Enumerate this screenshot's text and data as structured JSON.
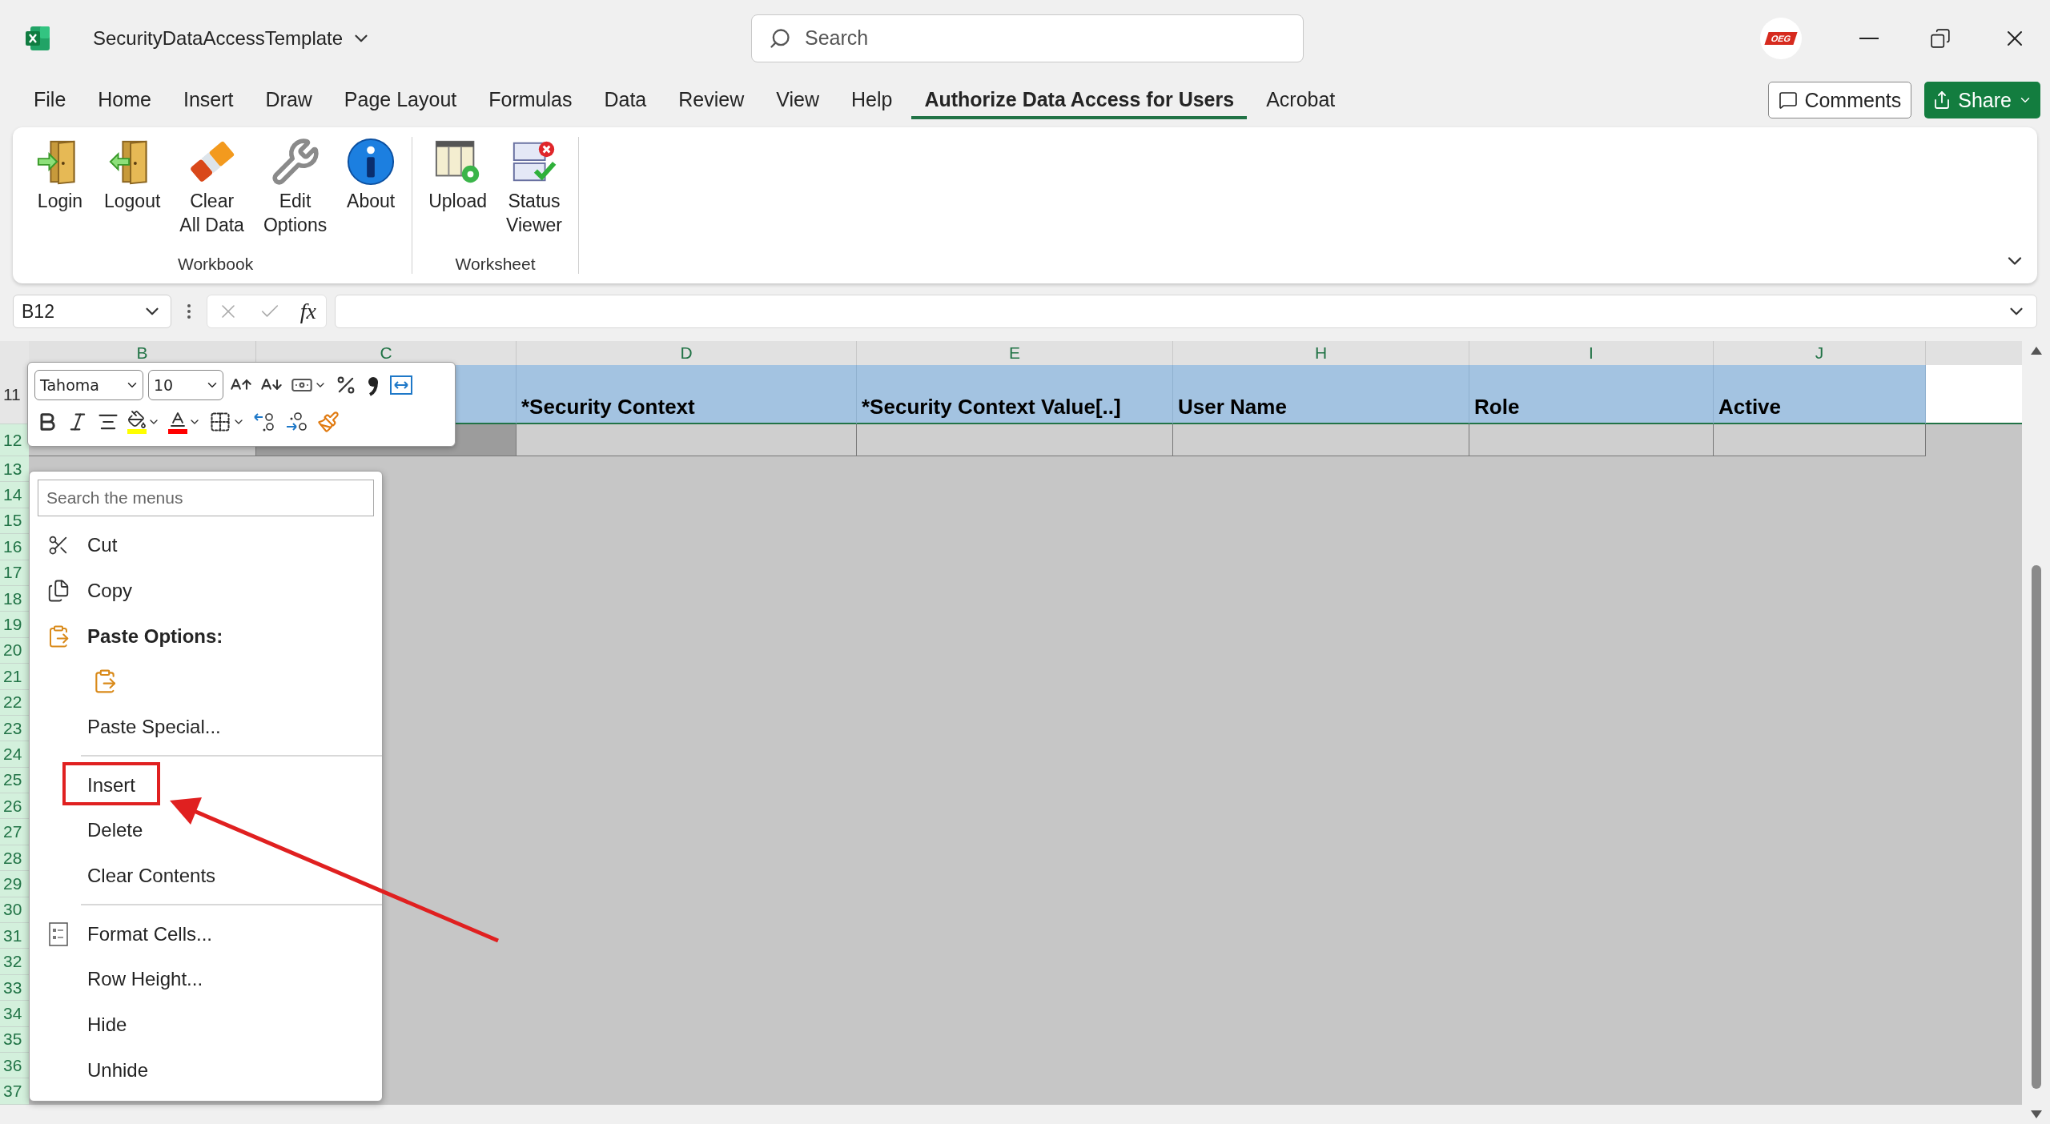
{
  "app": {
    "title": "SecurityDataAccessTemplate",
    "search_placeholder": "Search",
    "account_badge": "OEG"
  },
  "menu_tabs": [
    {
      "label": "File",
      "selected": false
    },
    {
      "label": "Home",
      "selected": false
    },
    {
      "label": "Insert",
      "selected": false
    },
    {
      "label": "Draw",
      "selected": false
    },
    {
      "label": "Page Layout",
      "selected": false
    },
    {
      "label": "Formulas",
      "selected": false
    },
    {
      "label": "Data",
      "selected": false
    },
    {
      "label": "Review",
      "selected": false
    },
    {
      "label": "View",
      "selected": false
    },
    {
      "label": "Help",
      "selected": false
    },
    {
      "label": "Authorize Data Access for Users",
      "selected": true
    },
    {
      "label": "Acrobat",
      "selected": false
    }
  ],
  "actions": {
    "comments": "Comments",
    "share": "Share"
  },
  "ribbon": {
    "groups": [
      {
        "label": "Workbook",
        "buttons": [
          {
            "lines": [
              "Login"
            ],
            "kind": "login"
          },
          {
            "lines": [
              "Logout"
            ],
            "kind": "logout"
          },
          {
            "lines": [
              "Clear",
              "All Data"
            ],
            "kind": "eraser"
          },
          {
            "lines": [
              "Edit",
              "Options"
            ],
            "kind": "wrench"
          },
          {
            "lines": [
              "About"
            ],
            "kind": "info"
          }
        ]
      },
      {
        "label": "Worksheet",
        "buttons": [
          {
            "lines": [
              "Upload"
            ],
            "kind": "upload"
          },
          {
            "lines": [
              "Status",
              "Viewer"
            ],
            "kind": "status"
          }
        ]
      }
    ]
  },
  "formula_bar": {
    "name_box": "B12",
    "function_label": "fx"
  },
  "mini_toolbar": {
    "font": "Tahoma",
    "size": "10",
    "rows": [
      [
        {
          "kind": "grow-font",
          "dropdown": false
        },
        {
          "kind": "shrink-font",
          "dropdown": false
        },
        {
          "kind": "accounting",
          "dropdown": true
        },
        {
          "kind": "percent",
          "dropdown": false
        },
        {
          "kind": "comma",
          "dropdown": false
        },
        {
          "kind": "merge",
          "dropdown": false
        }
      ],
      [
        {
          "kind": "bold",
          "dropdown": false
        },
        {
          "kind": "italic",
          "dropdown": false
        },
        {
          "kind": "center",
          "dropdown": false
        },
        {
          "kind": "fill-color",
          "dropdown": true,
          "color": "#ffff00"
        },
        {
          "kind": "font-color",
          "dropdown": true,
          "color": "#ff0000"
        },
        {
          "kind": "borders",
          "dropdown": true
        },
        {
          "kind": "increase-decimal",
          "dropdown": false
        },
        {
          "kind": "decrease-decimal",
          "dropdown": false
        },
        {
          "kind": "format-painter",
          "dropdown": false
        }
      ]
    ]
  },
  "context_menu": {
    "search_placeholder": "Search the menus",
    "items": [
      {
        "kind": "cut",
        "label": "Cut"
      },
      {
        "kind": "copy",
        "label": "Copy"
      },
      {
        "kind": "heading",
        "label": "Paste Options:"
      },
      {
        "kind": "paste-option"
      },
      {
        "kind": "item",
        "label": "Paste Special..."
      },
      {
        "kind": "separator"
      },
      {
        "kind": "item",
        "label": "Insert"
      },
      {
        "kind": "item",
        "label": "Delete"
      },
      {
        "kind": "item",
        "label": "Clear Contents"
      },
      {
        "kind": "separator"
      },
      {
        "kind": "format-cells",
        "label": "Format Cells..."
      },
      {
        "kind": "item",
        "label": "Row Height..."
      },
      {
        "kind": "item",
        "label": "Hide"
      },
      {
        "kind": "item",
        "label": "Unhide"
      }
    ]
  },
  "sheet": {
    "columns": [
      {
        "label": "B",
        "selected": true
      },
      {
        "label": "C",
        "selected": true
      },
      {
        "label": "D",
        "selected": true
      },
      {
        "label": "E",
        "selected": true
      },
      {
        "label": "H",
        "selected": true
      },
      {
        "label": "I",
        "selected": true
      },
      {
        "label": "J",
        "selected": true
      }
    ],
    "header_row": {
      "number": "11",
      "cells": [
        "*Security Context",
        "*Security Context Value[..]",
        "User Name",
        "Role",
        "Active"
      ]
    },
    "rows": [
      {
        "number": "12",
        "selected": true
      },
      {
        "number": "13",
        "selected": true
      },
      {
        "number": "14",
        "selected": true
      },
      {
        "number": "15",
        "selected": true
      },
      {
        "number": "16",
        "selected": true
      },
      {
        "number": "17",
        "selected": true
      },
      {
        "number": "18",
        "selected": true
      },
      {
        "number": "19",
        "selected": true
      },
      {
        "number": "20",
        "selected": true
      },
      {
        "number": "21",
        "selected": true
      },
      {
        "number": "22",
        "selected": true
      },
      {
        "number": "23",
        "selected": true
      },
      {
        "number": "24",
        "selected": true
      },
      {
        "number": "25",
        "selected": true
      },
      {
        "number": "26",
        "selected": true
      },
      {
        "number": "27",
        "selected": true
      },
      {
        "number": "28",
        "selected": true
      },
      {
        "number": "29",
        "selected": true
      },
      {
        "number": "30",
        "selected": true
      },
      {
        "number": "31",
        "selected": true
      },
      {
        "number": "32",
        "selected": true
      },
      {
        "number": "33",
        "selected": true
      },
      {
        "number": "34",
        "selected": true
      },
      {
        "number": "35",
        "selected": true
      },
      {
        "number": "36",
        "selected": true
      },
      {
        "number": "37",
        "selected": true
      }
    ]
  }
}
